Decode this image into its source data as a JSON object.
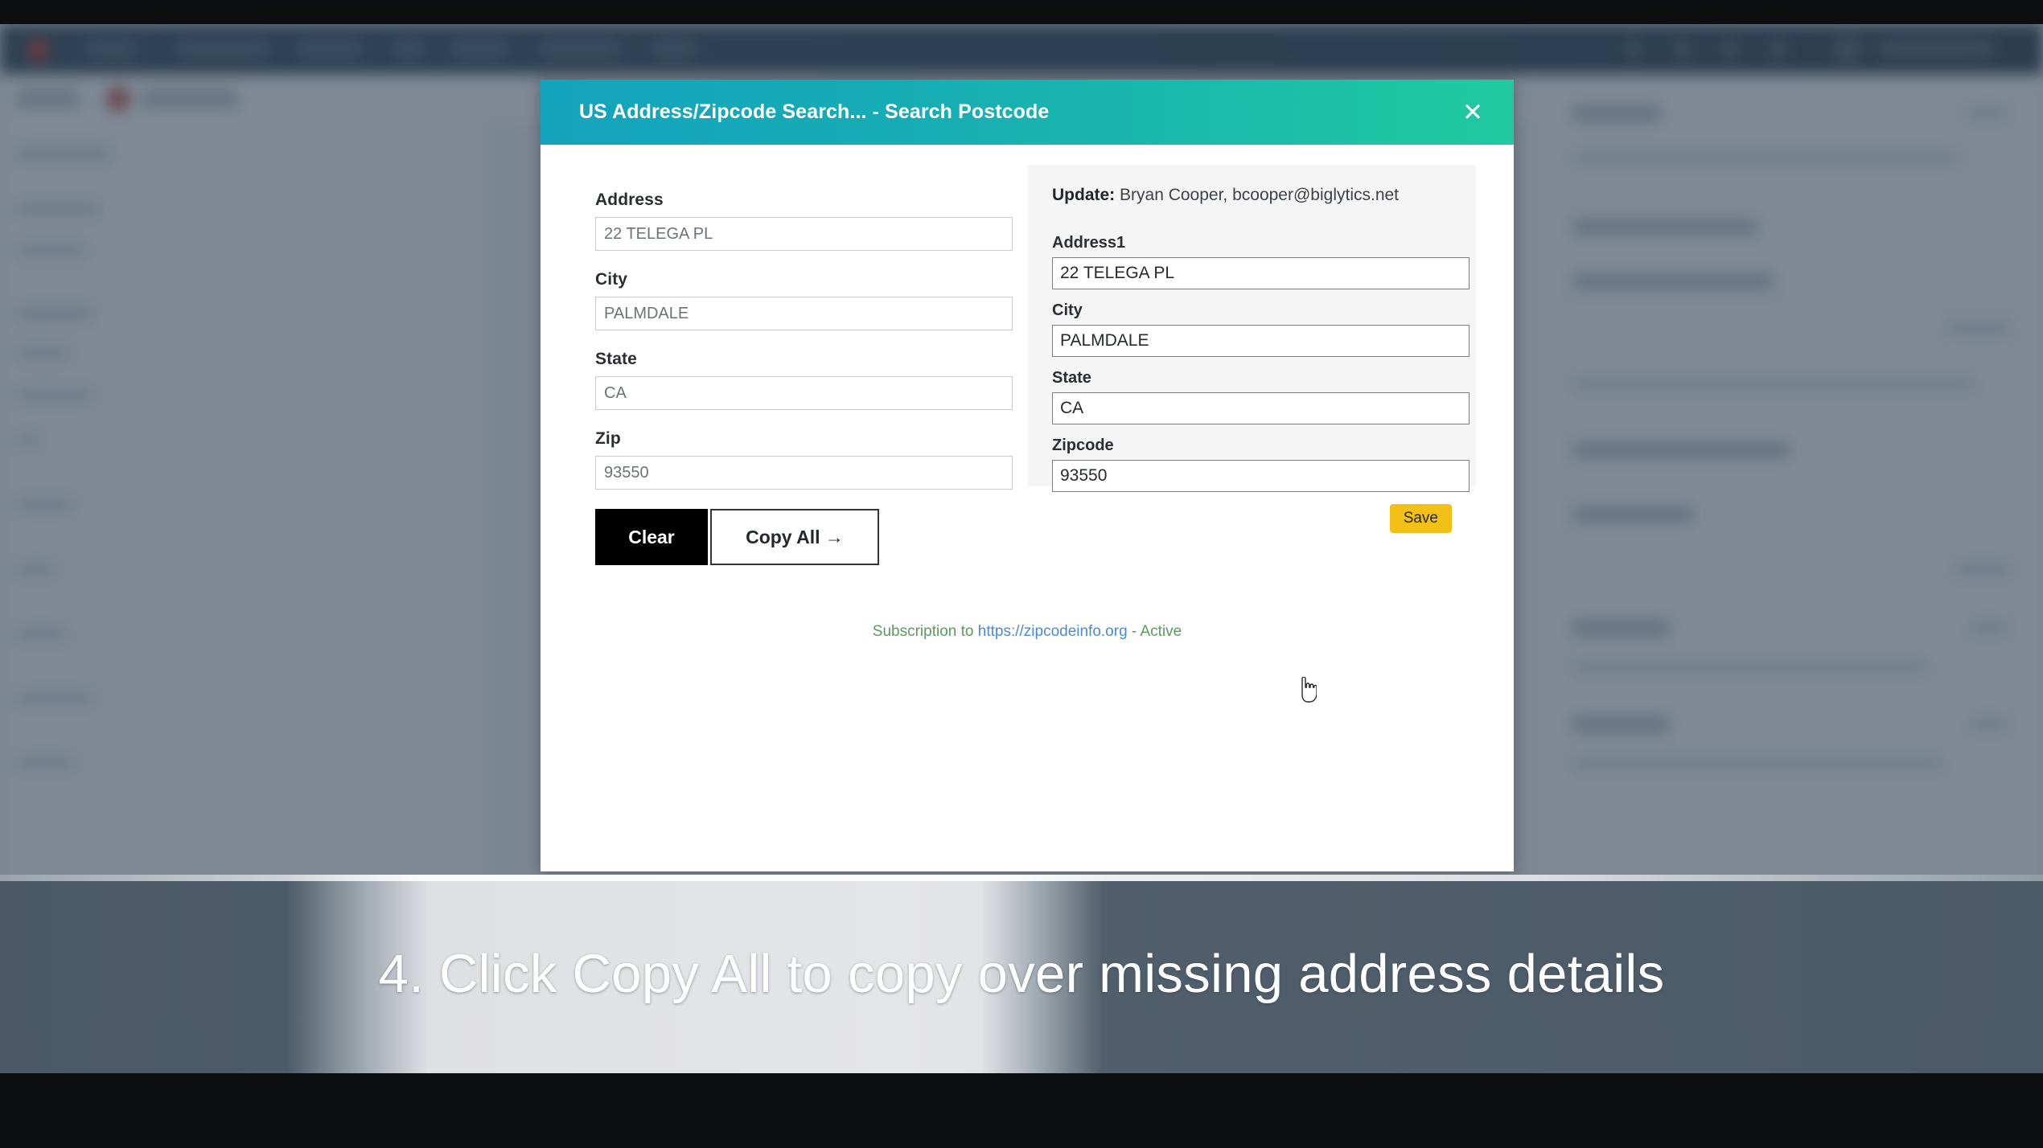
{
  "modal": {
    "title": "US Address/Zipcode Search... - Search Postcode",
    "close_label": "✕",
    "accent_start": "#13a3bd",
    "accent_end": "#20c9a0"
  },
  "search_form": {
    "fields": [
      {
        "label": "Address",
        "value": "22 TELEGA PL"
      },
      {
        "label": "City",
        "value": "PALMDALE"
      },
      {
        "label": "State",
        "value": "CA"
      },
      {
        "label": "Zip",
        "value": "93550"
      }
    ],
    "clear_label": "Clear",
    "copy_all_label": "Copy All →"
  },
  "update_panel": {
    "header_prefix": "Update:",
    "header_detail": "Bryan Cooper, bcooper@biglytics.net",
    "fields": [
      {
        "label": "Address1",
        "value": "22 TELEGA PL"
      },
      {
        "label": "City",
        "value": "PALMDALE"
      },
      {
        "label": "State",
        "value": "CA"
      },
      {
        "label": "Zipcode",
        "value": "93550"
      }
    ],
    "save_label": "Save",
    "save_color": "#f3c015"
  },
  "subscription": {
    "prefix": "Subscription to ",
    "link": "https://zipcodeinfo.org",
    "suffix": " - Active",
    "text_color": "#5a9a5e",
    "link_color": "#4b89d6"
  },
  "caption": {
    "text": "4. Click Copy All to copy over missing address details"
  }
}
